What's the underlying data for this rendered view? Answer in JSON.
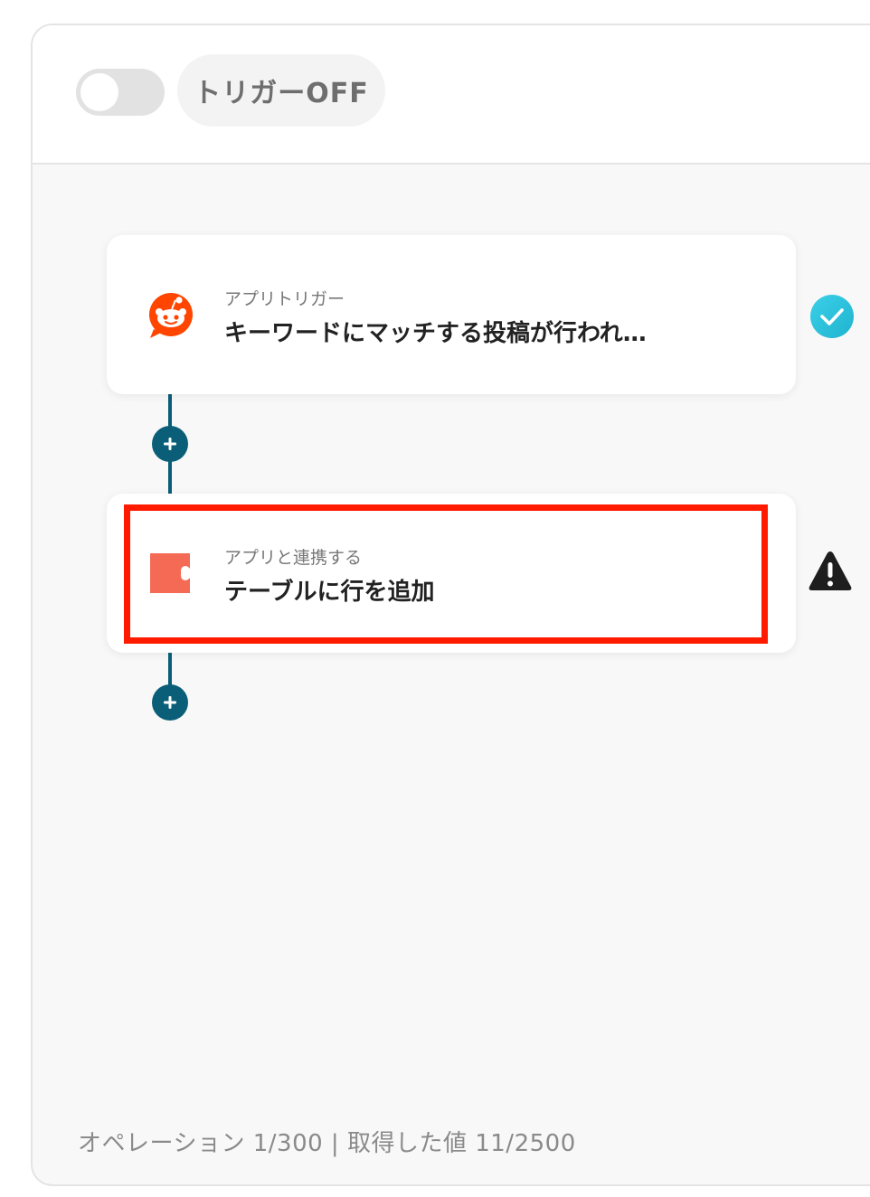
{
  "header": {
    "trigger_label": "トリガーOFF",
    "trigger_enabled": false
  },
  "steps": [
    {
      "subtitle": "アプリトリガー",
      "title": "キーワードにマッチする投稿が行われ…",
      "app_icon": "reddit-icon",
      "status": "completed",
      "status_icon": "check-circle-icon",
      "status_color": "#2cc0e0"
    },
    {
      "subtitle": "アプリと連携する",
      "title": "テーブルに行を追加",
      "app_icon": "coda-icon",
      "status": "warning",
      "status_icon": "warning-icon",
      "status_color": "#222222"
    }
  ],
  "footer": {
    "usage_text": "オペレーション 1/300 | 取得した値 11/2500"
  },
  "colors": {
    "connector": "#0b5e78",
    "highlight": "#ff1a00",
    "reddit": "#ff4500",
    "coda": "#f46a54"
  }
}
